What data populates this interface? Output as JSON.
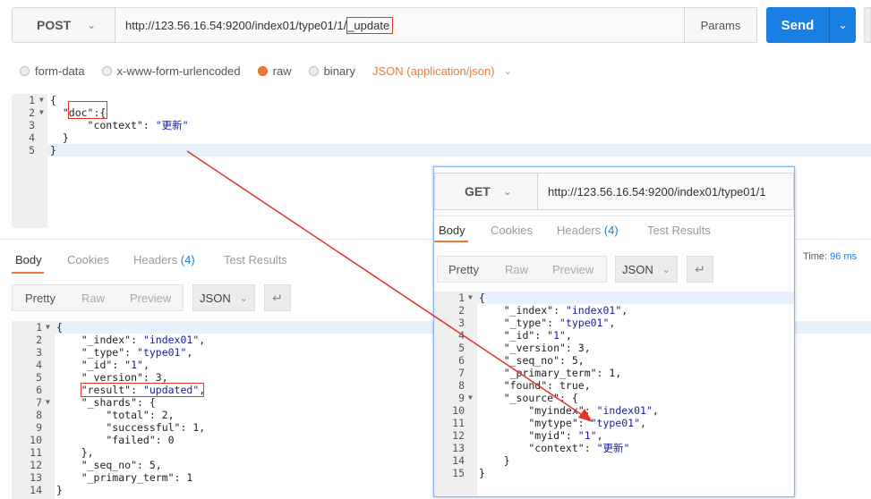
{
  "request": {
    "method": "POST",
    "url_prefix": "http://123.56.16.54:9200/index01/type01/1/",
    "url_highlight": "_update",
    "params_label": "Params",
    "send_label": "Send"
  },
  "body_types": {
    "options": [
      "form-data",
      "x-www-form-urlencoded",
      "raw",
      "binary"
    ],
    "selected": "raw",
    "format": "JSON (application/json)"
  },
  "request_body": {
    "line_numbers": [
      "1",
      "2",
      "3",
      "4",
      "5"
    ],
    "lines": [
      "{",
      "  \"doc\":{",
      "      \"context\": \"更新\"",
      "  }",
      "}"
    ]
  },
  "response_tabs": {
    "body": "Body",
    "cookies": "Cookies",
    "headers": "Headers",
    "headers_count": "(4)",
    "test_results": "Test Results",
    "time_label": "Time:",
    "time_value": "96 ms"
  },
  "view_options": {
    "pretty": "Pretty",
    "raw": "Raw",
    "preview": "Preview",
    "format": "JSON"
  },
  "response_body": {
    "line_numbers": [
      "1",
      "2",
      "3",
      "4",
      "5",
      "6",
      "7",
      "8",
      "9",
      "10",
      "11",
      "12",
      "13",
      "14"
    ],
    "lines": [
      "{",
      "    \"_index\": \"index01\",",
      "    \"_type\": \"type01\",",
      "    \"_id\": \"1\",",
      "    \"_version\": 3,",
      "    \"result\": \"updated\",",
      "    \"_shards\": {",
      "        \"total\": 2,",
      "        \"successful\": 1,",
      "        \"failed\": 0",
      "    },",
      "    \"_seq_no\": 5,",
      "    \"_primary_term\": 1",
      "}"
    ]
  },
  "overlay": {
    "method": "GET",
    "url": "http://123.56.16.54:9200/index01/type01/1",
    "line_numbers": [
      "1",
      "2",
      "3",
      "4",
      "5",
      "6",
      "7",
      "8",
      "9",
      "10",
      "11",
      "12",
      "13",
      "14",
      "15"
    ],
    "lines": [
      "{",
      "    \"_index\": \"index01\",",
      "    \"_type\": \"type01\",",
      "    \"_id\": \"1\",",
      "    \"_version\": 3,",
      "    \"_seq_no\": 5,",
      "    \"_primary_term\": 1,",
      "    \"found\": true,",
      "    \"_source\": {",
      "        \"myindex\": \"index01\",",
      "        \"mytype\": \"type01\",",
      "        \"myid\": \"1\",",
      "        \"context\": \"更新\"",
      "    }",
      "}"
    ]
  },
  "colors": {
    "send": "#1a7fe3",
    "accent": "#f07a34",
    "annotation": "#e0352b"
  },
  "icons": [
    "chevron-down-icon",
    "wrap-lines-icon",
    "fold-arrow-icon"
  ]
}
